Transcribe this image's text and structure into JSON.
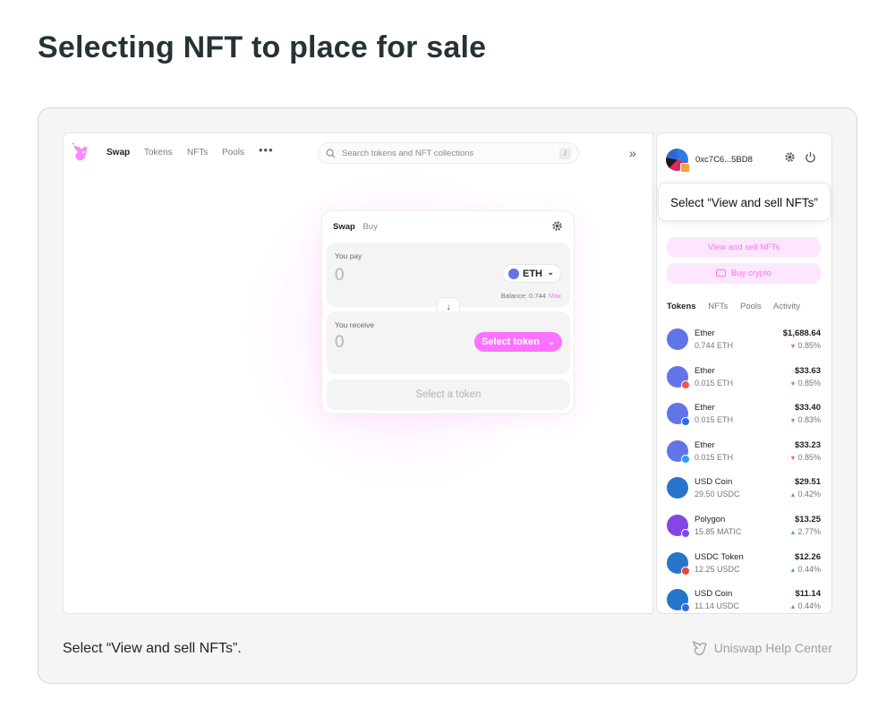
{
  "page": {
    "title": "Selecting NFT to place for sale",
    "caption": "Select “View and sell NFTs”.",
    "brand": "Uniswap Help Center"
  },
  "nav": {
    "items": [
      "Swap",
      "Tokens",
      "NFTs",
      "Pools"
    ],
    "more": "•••",
    "search_placeholder": "Search tokens and NFT collections",
    "search_shortcut": "/",
    "expand": "»"
  },
  "swap": {
    "tabs": [
      "Swap",
      "Buy"
    ],
    "pay_label": "You pay",
    "pay_amount": "0",
    "pay_token": "ETH",
    "balance": "Balance: 0.744",
    "max": "Max",
    "receive_label": "You receive",
    "receive_amount": "0",
    "select_token": "Select token",
    "cta": "Select a token",
    "accent": "#fc72ff"
  },
  "wallet": {
    "address": "0xc7C6...5BD8",
    "tooltip": "Select “View and sell NFTs”",
    "view_sell": "View and sell NFTs",
    "buy_crypto": "Buy crypto",
    "tabs": [
      "Tokens",
      "NFTs",
      "Pools",
      "Activity"
    ],
    "tokens": [
      {
        "name": "Ether",
        "balance": "0.744 ETH",
        "usd": "$1,688.64",
        "change": "0.85%",
        "dir": "down",
        "color": "#6275e8",
        "chain": ""
      },
      {
        "name": "Ether",
        "balance": "0.015 ETH",
        "usd": "$33.63",
        "change": "0.85%",
        "dir": "down",
        "color": "#6275e8",
        "chain": "#ff4d4d"
      },
      {
        "name": "Ether",
        "balance": "0.015 ETH",
        "usd": "$33.40",
        "change": "0.83%",
        "dir": "down",
        "color": "#6275e8",
        "chain": "#2b6def"
      },
      {
        "name": "Ether",
        "balance": "0.015 ETH",
        "usd": "$33.23",
        "change": "0.85%",
        "dir": "down",
        "color": "#6275e8",
        "chain": "#28a0f0"
      },
      {
        "name": "USD Coin",
        "balance": "29.50 USDC",
        "usd": "$29.51",
        "change": "0.42%",
        "dir": "up",
        "color": "#2775ca",
        "chain": ""
      },
      {
        "name": "Polygon",
        "balance": "15.85 MATIC",
        "usd": "$13.25",
        "change": "2.77%",
        "dir": "up",
        "color": "#8247e5",
        "chain": "#8247e5"
      },
      {
        "name": "USDC Token",
        "balance": "12.25 USDC",
        "usd": "$12.26",
        "change": "0.44%",
        "dir": "up",
        "color": "#2775ca",
        "chain": "#e84142"
      },
      {
        "name": "USD Coin",
        "balance": "11.14 USDC",
        "usd": "$11.14",
        "change": "0.44%",
        "dir": "up",
        "color": "#2775ca",
        "chain": "#2b6def"
      }
    ],
    "down_color": "#ff5f52",
    "up_color": "#40b66b"
  }
}
